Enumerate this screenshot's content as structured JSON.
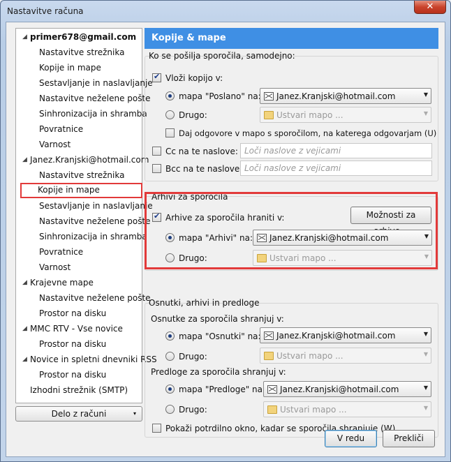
{
  "window": {
    "title": "Nastavitve računa",
    "close": "✕"
  },
  "tree": {
    "items": [
      {
        "label": "primer678@gmail.com",
        "type": "account"
      },
      {
        "label": "Nastavitve strežnika",
        "type": "child"
      },
      {
        "label": "Kopije in mape",
        "type": "child"
      },
      {
        "label": "Sestavljanje in naslavljanje",
        "type": "child"
      },
      {
        "label": "Nastavitve neželene pošte",
        "type": "child"
      },
      {
        "label": "Sinhronizacija in shramba",
        "type": "child"
      },
      {
        "label": "Povratnice",
        "type": "child"
      },
      {
        "label": "Varnost",
        "type": "child"
      },
      {
        "label": "Janez.Kranjski@hotmail.com",
        "type": "account"
      },
      {
        "label": "Nastavitve strežnika",
        "type": "child"
      },
      {
        "label": "Kopije in mape",
        "type": "child-selected"
      },
      {
        "label": "Sestavljanje in naslavljanje",
        "type": "child"
      },
      {
        "label": "Nastavitve neželene pošte",
        "type": "child"
      },
      {
        "label": "Sinhronizacija in shramba",
        "type": "child"
      },
      {
        "label": "Povratnice",
        "type": "child"
      },
      {
        "label": "Varnost",
        "type": "child"
      },
      {
        "label": "Krajevne mape",
        "type": "account"
      },
      {
        "label": "Nastavitve neželene pošte",
        "type": "child"
      },
      {
        "label": "Prostor na disku",
        "type": "child"
      },
      {
        "label": "MMC RTV - Vse novice",
        "type": "account"
      },
      {
        "label": "Prostor na disku",
        "type": "child"
      },
      {
        "label": "Novice in spletni dnevniki RSS",
        "type": "account"
      },
      {
        "label": "Prostor na disku",
        "type": "child"
      },
      {
        "label": "Izhodni strežnik (SMTP)",
        "type": "plain"
      }
    ],
    "actions_button": "Delo z računi",
    "actions_arrow": "▾"
  },
  "panel": {
    "title": "Kopije & mape",
    "send": {
      "heading": "Ko se pošilja sporočila, samodejno:",
      "copy_label": "Vloži kopijo v:",
      "folder_sent_label": "mapa \"Poslano\" na:",
      "folder_sent_value": "Janez.Kranjski@hotmail.com",
      "other_label": "Drugo:",
      "other_value": "Ustvari mapo ...",
      "reply_label": "Daj odgovore v mapo s sporočilom, na katerega odgovarjam (U)",
      "cc_label": "Cc na te naslove:",
      "cc_placeholder": "Loči naslove z vejicami",
      "bcc_label": "Bcc na te naslove:",
      "bcc_placeholder": "Loči naslove z vejicami"
    },
    "archive": {
      "heading": "Arhivi za sporočila",
      "keep_label": "Arhive za sporočila hraniti v:",
      "options_button": "Možnosti za arhive...",
      "folder_label": "mapa \"Arhivi\" na:",
      "folder_value": "Janez.Kranjski@hotmail.com",
      "other_label": "Drugo:",
      "other_value": "Ustvari mapo ..."
    },
    "drafts": {
      "heading": "Osnutki, arhivi in predloge",
      "drafts_heading": "Osnutke za sporočila shranjuj v:",
      "drafts_folder_label": "mapa \"Osnutki\" na:",
      "drafts_folder_value": "Janez.Kranjski@hotmail.com",
      "drafts_other_label": "Drugo:",
      "drafts_other_value": "Ustvari mapo ...",
      "templates_heading": "Predloge za sporočila shranjuj v:",
      "templates_folder_label": "mapa \"Predloge\" na:",
      "templates_folder_value": "Janez.Kranjski@hotmail.com",
      "templates_other_label": "Drugo:",
      "templates_other_value": "Ustvari mapo ...",
      "confirm_label": "Pokaži potrdilno okno, kadar se sporočila shranjuje (W)"
    }
  },
  "buttons": {
    "ok": "V redu",
    "cancel": "Prekliči"
  },
  "colors": {
    "header_bg": "#3f8fe4",
    "highlight": "#e23a3a"
  }
}
